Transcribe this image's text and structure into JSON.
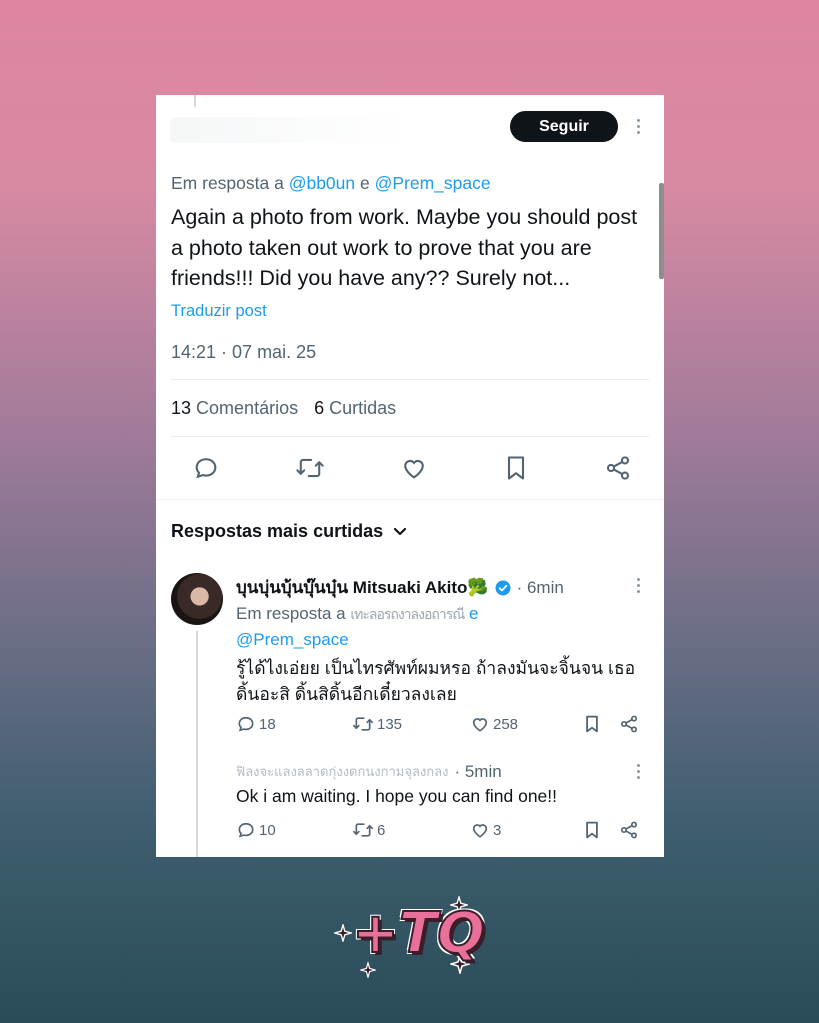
{
  "header": {
    "follow_label": "Seguir"
  },
  "tweet": {
    "reply_prefix": "Em resposta a ",
    "mention_1": "@bb0un",
    "conjunction": " e ",
    "mention_2": "@Prem_space",
    "text": "Again a photo from work.  Maybe you should post a photo taken out work to prove that you are friends!!! Did you have any?? Surely not...",
    "translate_label": "Traduzir post",
    "timestamp": "14:21 · 07 mai. 25",
    "comments_count": "13",
    "comments_label": "Comentários",
    "likes_count": "6",
    "likes_label": "Curtidas"
  },
  "actions": {
    "icons": [
      "reply-icon",
      "retweet-icon",
      "like-icon",
      "bookmark-icon",
      "share-icon"
    ]
  },
  "replies": {
    "sort_label": "Respostas mais curtidas",
    "items": [
      {
        "name": "บุนบุ่นบุ้นบุ๊นบุ๋น Mitsuaki Akito🥦",
        "time": "· 6min",
        "reply_prefix": "Em resposta a ",
        "blurred_mention": "เทะลอรถงาลงอถารณี",
        "conjunction": " e",
        "mention_2": "@Prem_space",
        "text": "รู้ได้ไงเอ่ยย เป็นไทรศัพท์ผมหรอ ถ้าลงมันจะจิ้นจน เธอดิ้นอะสิ ดิ้นสิดิ้นอีกเดี๋ยวลงเลย",
        "replies": "18",
        "reposts": "135",
        "likes": "258"
      },
      {
        "blurred_name": "ฟิลงจะแลงลลาดกุ่งงดกนงกามจุลงกลง",
        "time": "· 5min",
        "text": "Ok i am waiting. I hope you can find one!!",
        "replies": "10",
        "reposts": "6",
        "likes": "3"
      }
    ]
  },
  "sticker": {
    "text": "+TQ"
  },
  "colors": {
    "accent": "#1d9bf0",
    "follow_bg": "#0f1419",
    "sticker_pink": "#e8709a"
  }
}
